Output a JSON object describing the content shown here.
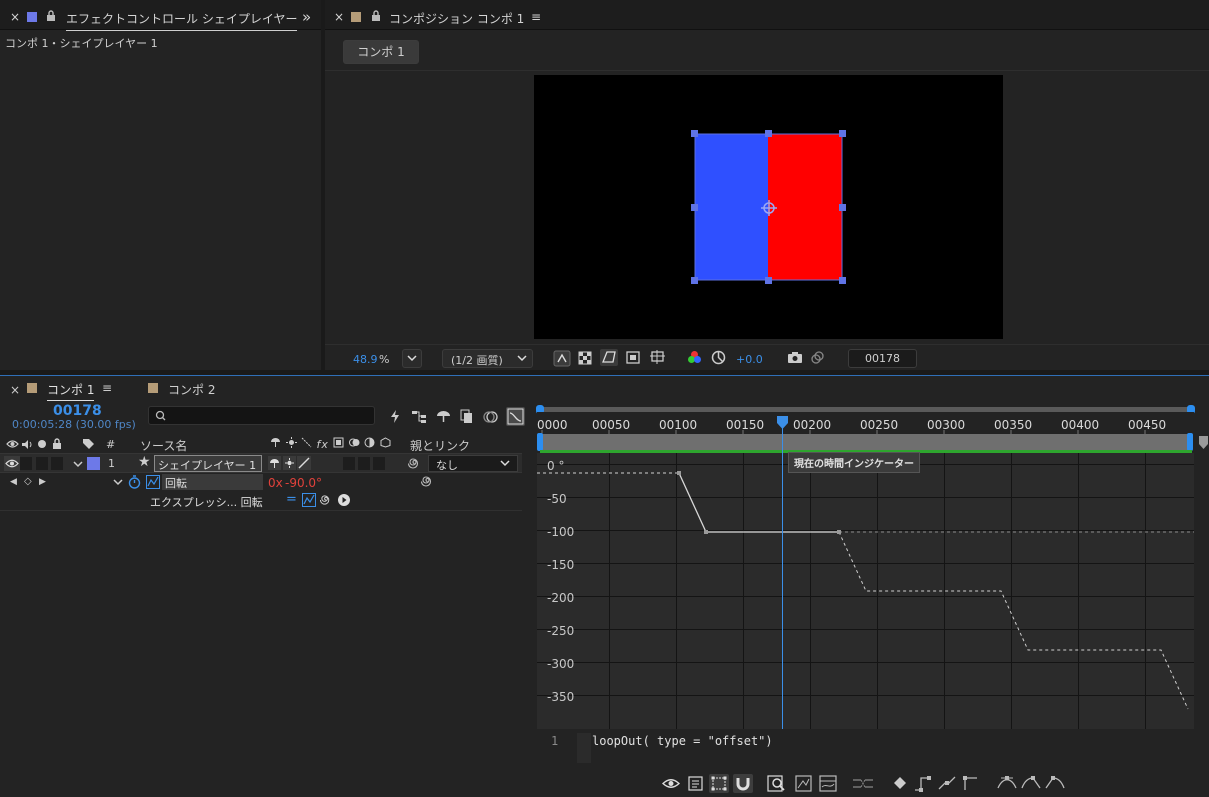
{
  "effect_panel": {
    "close": "×",
    "title": "エフェクトコントロール シェイプレイヤー",
    "more": "»",
    "breadcrumb": "コンポ 1・シェイプレイヤー 1"
  },
  "comp_panel": {
    "close": "×",
    "title": "コンポジション コンポ 1",
    "menu": "≡",
    "comp_tab": "コンポ 1",
    "zoom_value": "48.9",
    "zoom_unit": "%",
    "resolution": "(1/2 画質)",
    "exposure": "+0.0",
    "timecode": "00178"
  },
  "timeline": {
    "tab1_close": "×",
    "tab1": "コンポ 1",
    "tab1_menu": "≡",
    "tab2": "コンポ 2",
    "current_frame": "00178",
    "current_time": "0:00:05:28 (30.00 fps)",
    "search_placeholder": "",
    "col_num": "#",
    "col_source": "ソース名",
    "col_parent": "親とリンク",
    "layer_num": "1",
    "layer_name": "シェイプレイヤー 1",
    "parent_value": "なし",
    "prop_name": "回転",
    "prop_value_prefix": "0x",
    "prop_value": "-90.0°",
    "expr_label": "エクスプレッシ... 回転"
  },
  "ruler": {
    "labels": [
      "0000",
      "00050",
      "00100",
      "00150",
      "00200",
      "00250",
      "00300",
      "00350",
      "00400",
      "00450"
    ],
    "tooltip": "現在の時間インジケーター"
  },
  "graph": {
    "y_labels": [
      "0 °",
      "-50",
      "-100",
      "-150",
      "-200",
      "-250",
      "-300",
      "-350"
    ]
  },
  "expression": {
    "line_number": "1",
    "code": "loopOut( type = \"offset\")"
  },
  "colors": {
    "accent_blue": "#3b8fe8",
    "layer_blue": "#2f50ff",
    "layer_red": "#ff0000",
    "work_area_green": "#2ea52e",
    "value_red": "#e0413b"
  }
}
